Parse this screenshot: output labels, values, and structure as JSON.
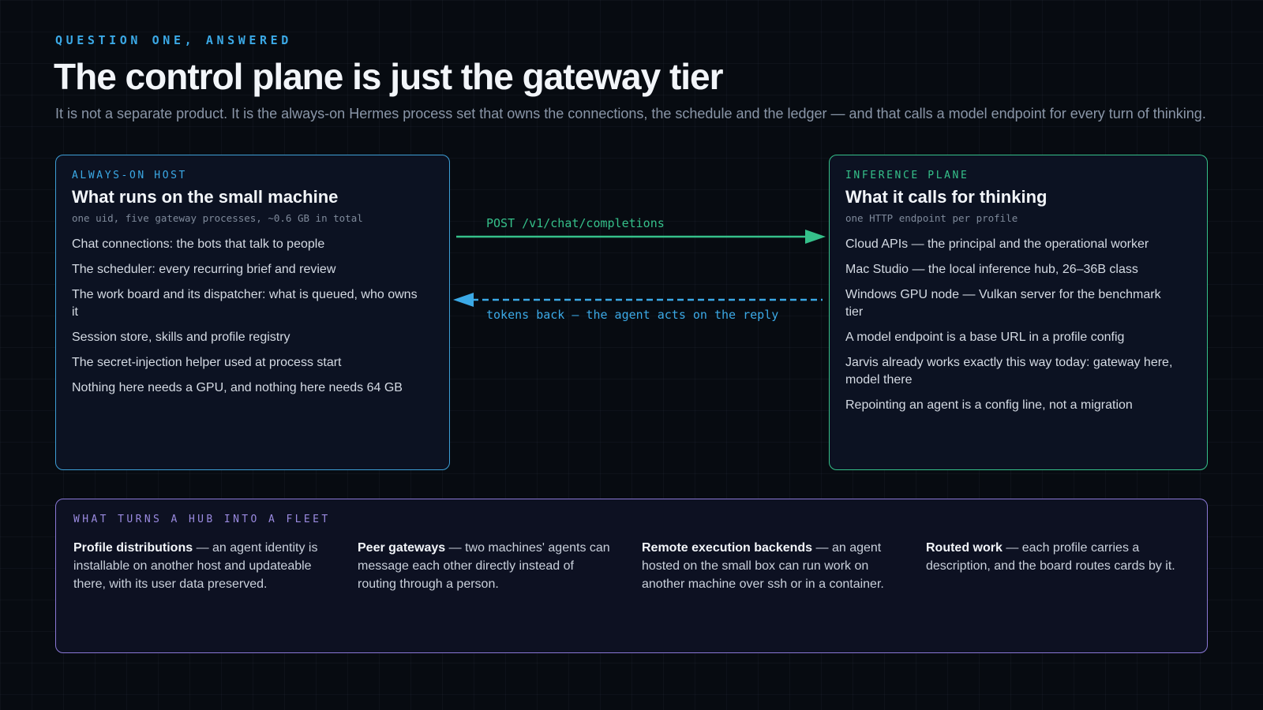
{
  "header": {
    "eyebrow": "QUESTION ONE, ANSWERED",
    "title": "The control plane is just the gateway tier",
    "subtitle": "It is not a separate product. It is the always-on Hermes process set that owns the connections, the schedule and the ledger — and that calls a model endpoint for every turn of thinking."
  },
  "left_card": {
    "tag": "ALWAYS-ON HOST",
    "heading": "What runs on the small machine",
    "note": "one uid, five gateway processes, ~0.6 GB in total",
    "items": [
      "Chat connections: the bots that talk to people",
      "The scheduler: every recurring brief and review",
      "The work board and its dispatcher: what is queued, who owns it",
      "Session store, skills and profile registry",
      "The secret-injection helper used at process start",
      "Nothing here needs a GPU, and nothing here needs 64 GB"
    ],
    "border_color": "#3d9ed6"
  },
  "right_card": {
    "tag": "INFERENCE PLANE",
    "heading": "What it calls for thinking",
    "note": "one HTTP endpoint per profile",
    "items": [
      "Cloud APIs — the principal and the operational worker",
      "Mac Studio — the local inference hub, 26–36B class",
      "Windows GPU node — Vulkan server for the benchmark tier",
      "A model endpoint is a base URL in a profile config",
      "Jarvis already works exactly this way today: gateway here, model there",
      "Repointing an agent is a config line, not a migration"
    ],
    "border_color": "#35c08a"
  },
  "arrows": {
    "request_label": "POST /v1/chat/completions",
    "response_label": "tokens back — the agent acts on the reply",
    "request_color": "#35c08a",
    "response_color": "#3ba9e6"
  },
  "fleet": {
    "tag": "WHAT TURNS A HUB INTO A FLEET",
    "columns": [
      {
        "title": "Profile distributions",
        "text": " — an agent identity is installable on another host and updateable there, with its user data preserved."
      },
      {
        "title": "Peer gateways",
        "text": " — two machines' agents can message each other directly instead of routing through a person."
      },
      {
        "title": "Remote execution backends",
        "text": " — an agent hosted on the small box can run work on another machine over ssh or in a container."
      },
      {
        "title": "Routed work",
        "text": " — each profile carries a description, and the board routes cards by it."
      }
    ],
    "border_color": "#8a78d6"
  }
}
